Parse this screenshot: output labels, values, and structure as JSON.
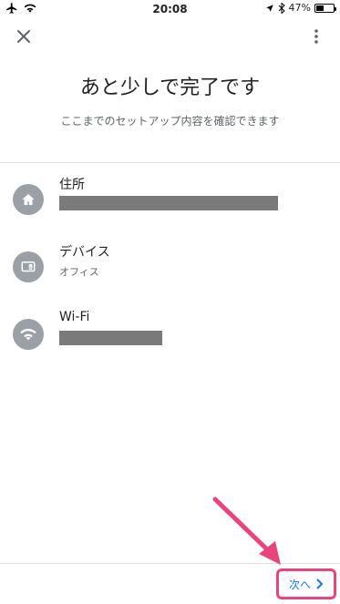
{
  "status": {
    "time": "20:08",
    "battery_text": "47%",
    "battery_level": 0.47
  },
  "header": {
    "title": "あと少しで完了です",
    "subtitle": "ここまでのセットアップ内容を確認できます"
  },
  "items": [
    {
      "label": "住所",
      "icon": "home-icon",
      "value": "",
      "redacted": true
    },
    {
      "label": "デバイス",
      "icon": "speaker-device-icon",
      "value": "オフィス"
    },
    {
      "label": "Wi-Fi",
      "icon": "wifi-icon",
      "value": "",
      "redacted": true
    }
  ],
  "footer": {
    "next_label": "次へ"
  },
  "colors": {
    "accent": "#1a73e8",
    "annotation": "#e8457d",
    "icon_bg": "#9aa0a6"
  }
}
